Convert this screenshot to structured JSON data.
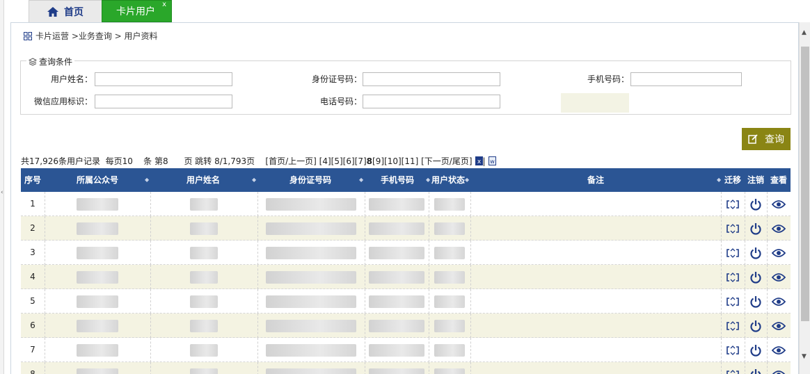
{
  "tabs": {
    "home_label": "首页",
    "active_label": "卡片用户",
    "close_glyph": "x"
  },
  "breadcrumb": "卡片运营 >业务查询 > 用户资料",
  "query": {
    "legend": "查询条件",
    "fields": [
      {
        "label": "用户姓名：",
        "value": ""
      },
      {
        "label": "身份证号码：",
        "value": ""
      },
      {
        "label": "手机号码：",
        "value": ""
      },
      {
        "label": "微信应用标识：",
        "value": ""
      },
      {
        "label": "电话号码：",
        "value": ""
      }
    ],
    "search_label": "查询"
  },
  "pager": {
    "summary": "共17,926条用户记录  每页10    条 第8      页 跳转 8/1,793页    ",
    "first_prev": "[首页/上一页]",
    "pages": [
      "[4]",
      "[5]",
      "[6]",
      "[7]",
      "8",
      "[9]",
      "[10]",
      "[11]"
    ],
    "current_page": "8",
    "next_last": "[下一页/尾页]"
  },
  "grid": {
    "columns": [
      "序号",
      "所属公众号",
      "用户姓名",
      "身份证号码",
      "手机号码",
      "用户状态",
      "备注",
      "迁移",
      "注销",
      "查看"
    ],
    "rows": [
      {
        "no": "1",
        "account": "鼎…联",
        "name": "黎…涛",
        "id": "…40419980…034812",
        "phone": "…594…646467",
        "status": "…用中",
        "note": ""
      },
      {
        "no": "2",
        "account": "…联",
        "name": "…",
        "id": "1…4031975…",
        "phone": "…394…8597",
        "status": "…中",
        "note": ""
      },
      {
        "no": "3",
        "account": "…联",
        "name": "…",
        "id": "…302…30…4",
        "phone": "…760…13",
        "status": "…中",
        "note": ""
      },
      {
        "no": "4",
        "account": "鼎…联",
        "name": "…",
        "id": "…619…197",
        "phone": "…3",
        "status": "…中",
        "note": ""
      },
      {
        "no": "5",
        "account": "…联",
        "name": "…",
        "id": "…502619…32",
        "phone": "…74…58",
        "status": "…用中",
        "note": ""
      },
      {
        "no": "6",
        "account": "鼎…联",
        "name": "…",
        "id": "…4…0120…225",
        "phone": "…61…71",
        "status": "…用中",
        "note": ""
      },
      {
        "no": "7",
        "account": "鼎…联",
        "name": "…",
        "id": "…50…2619841…25532",
        "phone": "13…22",
        "status": "…用中",
        "note": ""
      },
      {
        "no": "8",
        "account": "…",
        "name": "…",
        "id": "…",
        "phone": "…",
        "status": "…",
        "note": ""
      }
    ]
  },
  "colors": {
    "header_bg": "#2b5594",
    "active_tab": "#2aa72a",
    "search_btn": "#8a8514",
    "alt_row": "#f4f3e2",
    "icon": "#1f3c88"
  }
}
